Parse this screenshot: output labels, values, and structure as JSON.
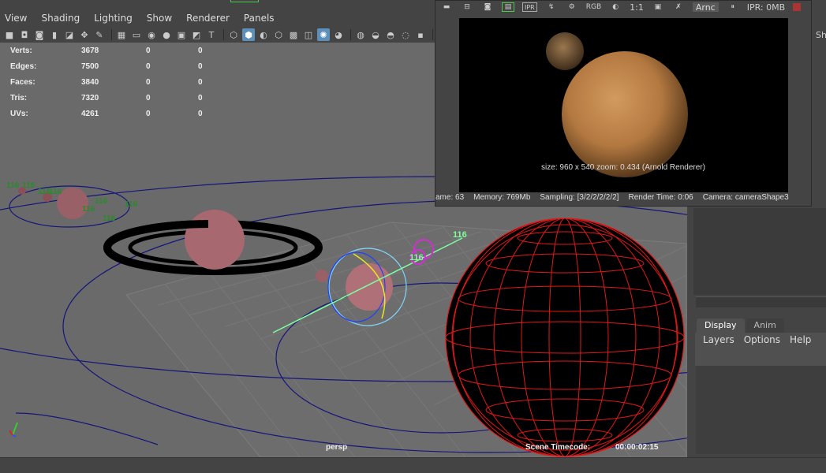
{
  "menu": {
    "items": [
      "View",
      "Shading",
      "Lighting",
      "Show",
      "Renderer",
      "Panels"
    ]
  },
  "toolbar": {
    "icons": [
      "camera-icon",
      "camera-attributes-icon",
      "bookmark-icon",
      "bookmark-icon-2",
      "image-plane-icon",
      "grid-icon",
      "film-gate-icon",
      "resolution-gate-icon",
      "gate-mask-icon",
      "field-chart-icon",
      "safe-action-icon",
      "safe-title-icon",
      "wireframe-icon",
      "smooth-shade-icon",
      "default-material-icon",
      "wireframe-on-shaded-icon",
      "xray-icon",
      "xray-joints-icon",
      "use-all-lights-icon",
      "shadows-icon",
      "screen-space-ao-icon",
      "motion-blur-icon",
      "anti-aliasing-icon",
      "depth-of-field-icon",
      "isolate-select-icon",
      "select-camera-icon"
    ]
  },
  "hud": {
    "stats": [
      {
        "label": "Verts:",
        "v1": "3678",
        "v2": "0",
        "v3": "0"
      },
      {
        "label": "Edges:",
        "v1": "7500",
        "v2": "0",
        "v3": "0"
      },
      {
        "label": "Faces:",
        "v1": "3840",
        "v2": "0",
        "v3": "0"
      },
      {
        "label": "Tris:",
        "v1": "7320",
        "v2": "0",
        "v3": "0"
      },
      {
        "label": "UVs:",
        "v1": "4261",
        "v2": "0",
        "v3": "0"
      }
    ],
    "camera": "persp",
    "timecode_label": "Scene Timecode:",
    "timecode_value": "00:00:02:15",
    "frame_labels": [
      "116",
      "116",
      "116",
      "116",
      "116",
      "116",
      "116",
      "116",
      "116",
      "116",
      "116"
    ]
  },
  "render_view": {
    "toolbar_items": [
      "RGB",
      "1:1",
      "IPR",
      "Arnc",
      "IPR: 0MB"
    ],
    "info": "size: 960 x 540 zoom: 0.434     (Arnold Renderer)",
    "status": [
      "ame: 63",
      "Memory: 769Mb",
      "Sampling: [3/2/2/2/2/2]",
      "Render Time: 0:06",
      "Camera: cameraShape3"
    ]
  },
  "right_panel": {
    "sh_label": "Sh",
    "tabs": [
      "Display",
      "Anim"
    ],
    "menu": [
      "Layers",
      "Options",
      "Help"
    ]
  },
  "colors": {
    "viewport_bg": "#6a6a6a",
    "wireframe_red": "#e01818",
    "selection_green": "#7dff9e",
    "frame_label_green": "#2a8a2a",
    "orbit_blue": "#15157a",
    "active_tab": "#5e8fb8"
  }
}
